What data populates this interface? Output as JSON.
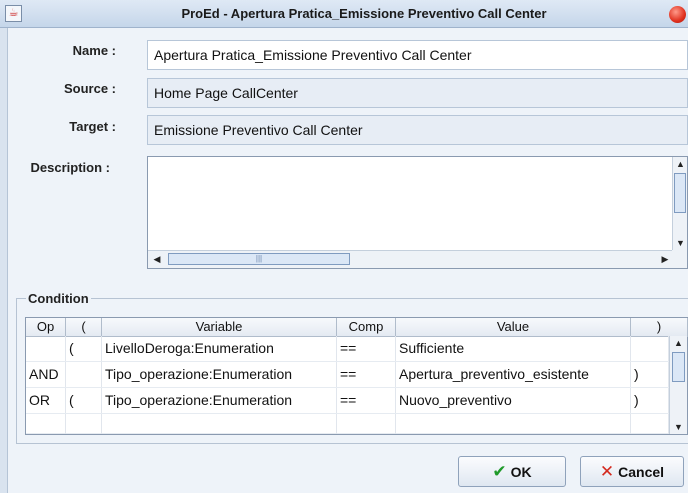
{
  "window": {
    "title": "ProEd - Apertura Pratica_Emissione Preventivo Call Center"
  },
  "form": {
    "name_label": "Name :",
    "name_value": "Apertura Pratica_Emissione Preventivo Call Center",
    "source_label": "Source :",
    "source_value": "Home Page CallCenter",
    "target_label": "Target :",
    "target_value": "Emissione Preventivo Call Center",
    "description_label": "Description :",
    "description_value": ""
  },
  "condition": {
    "legend": "Condition",
    "columns": [
      "Op",
      "(",
      "Variable",
      "Comp",
      "Value",
      ")"
    ],
    "rows": [
      [
        "",
        "(",
        "LivelloDeroga:Enumeration",
        "==",
        "Sufficiente",
        ""
      ],
      [
        "AND",
        "",
        "Tipo_operazione:Enumeration",
        "==",
        "Apertura_preventivo_esistente",
        ")"
      ],
      [
        "OR",
        "(",
        "Tipo_operazione:Enumeration",
        "==",
        "Nuovo_preventivo",
        ")"
      ],
      [
        "",
        "",
        "",
        "",
        "",
        ""
      ]
    ]
  },
  "buttons": {
    "ok": "OK",
    "cancel": "Cancel"
  },
  "colors": {
    "ok_check": "#1f9a2a",
    "cancel_x": "#d42a1f"
  },
  "icons": [
    "java-app-icon",
    "close-icon",
    "check-icon",
    "cross-icon",
    "scroll-arrow-icon"
  ]
}
